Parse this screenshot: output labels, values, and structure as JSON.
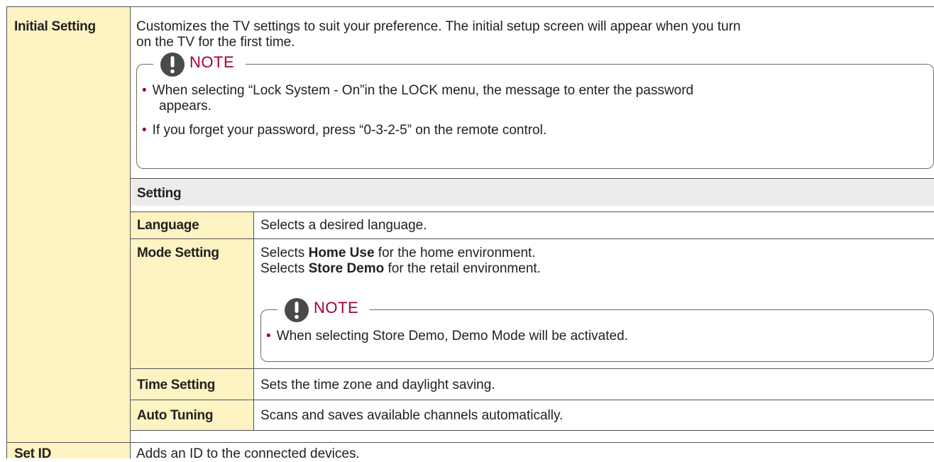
{
  "colors": {
    "label_bg": "#fef3c2",
    "header_bg": "#ececec",
    "note_accent": "#a50034",
    "text": "#231f20",
    "border": "#555555"
  },
  "initial": {
    "label": "Initial Setting",
    "desc_line1": "Customizes the TV settings to suit your preference. The initial setup screen will appear when you turn",
    "desc_line2": "on the TV for the first time.",
    "note": {
      "title": "NOTE",
      "icon": "exclamation-icon",
      "b1_line1": "When selecting “Lock System - On”in the LOCK menu, the message to enter the password",
      "b1_line2": "appears.",
      "b2": "If you forget your password, press “0-3-2-5” on the remote control.",
      "bullet": "•"
    }
  },
  "setting_header": "Setting",
  "rows": {
    "language": {
      "label": "Language",
      "desc": "Selects a desired language."
    },
    "mode": {
      "label": "Mode Setting",
      "l1_pre": "Selects ",
      "l1_kw": "Home Use",
      "l1_post": " for the home environment.",
      "l2_pre": "Selects ",
      "l2_kw": "Store Demo",
      "l2_post": " for the retail environment.",
      "note_title": "NOTE",
      "note_bullet": "When selecting Store Demo, Demo Mode will be activated."
    },
    "time": {
      "label": "Time Setting",
      "desc": "Sets the time zone and daylight saving."
    },
    "auto": {
      "label": "Auto Tuning",
      "desc": "Scans and saves available channels automatically."
    }
  },
  "setid": {
    "label": "Set ID",
    "desc": "Adds an ID to the connected devices."
  }
}
